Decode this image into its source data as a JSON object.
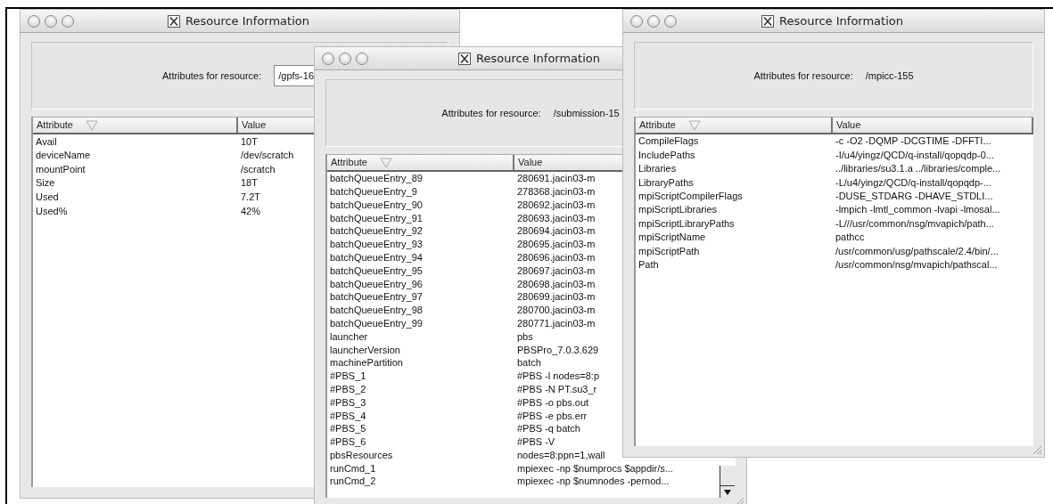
{
  "windows": [
    {
      "title": "Resource Information",
      "resource_label": "Attributes for resource:",
      "resource_value": "/gpfs-16",
      "value_boxed": true,
      "columns": [
        "Attribute",
        "Value"
      ],
      "scrollbar": false,
      "rows": [
        {
          "attribute": "Avail",
          "value": "10T"
        },
        {
          "attribute": "deviceName",
          "value": "/dev/scratch"
        },
        {
          "attribute": "mountPoint",
          "value": "/scratch"
        },
        {
          "attribute": "Size",
          "value": "18T"
        },
        {
          "attribute": "Used",
          "value": "7.2T"
        },
        {
          "attribute": "Used%",
          "value": "42%"
        }
      ]
    },
    {
      "title": "Resource Information",
      "resource_label": "Attributes for resource:",
      "resource_value": "/submission-15",
      "value_boxed": false,
      "columns": [
        "Attribute",
        "Value"
      ],
      "scrollbar": true,
      "rows": [
        {
          "attribute": "batchQueueEntry_89",
          "value": "280691.jacin03-m"
        },
        {
          "attribute": "batchQueueEntry_9",
          "value": "278368.jacin03-m"
        },
        {
          "attribute": "batchQueueEntry_90",
          "value": "280692.jacin03-m"
        },
        {
          "attribute": "batchQueueEntry_91",
          "value": "280693.jacin03-m"
        },
        {
          "attribute": "batchQueueEntry_92",
          "value": "280694.jacin03-m"
        },
        {
          "attribute": "batchQueueEntry_93",
          "value": "280695.jacin03-m"
        },
        {
          "attribute": "batchQueueEntry_94",
          "value": "280696.jacin03-m"
        },
        {
          "attribute": "batchQueueEntry_95",
          "value": "280697.jacin03-m"
        },
        {
          "attribute": "batchQueueEntry_96",
          "value": "280698.jacin03-m"
        },
        {
          "attribute": "batchQueueEntry_97",
          "value": "280699.jacin03-m"
        },
        {
          "attribute": "batchQueueEntry_98",
          "value": "280700.jacin03-m"
        },
        {
          "attribute": "batchQueueEntry_99",
          "value": "280771.jacin03-m"
        },
        {
          "attribute": "launcher",
          "value": "pbs"
        },
        {
          "attribute": "launcherVersion",
          "value": "PBSPro_7.0.3.629"
        },
        {
          "attribute": "machinePartition",
          "value": "batch"
        },
        {
          "attribute": "#PBS_1",
          "value": "#PBS -l nodes=8:p"
        },
        {
          "attribute": "#PBS_2",
          "value": "#PBS -N PT.su3_r"
        },
        {
          "attribute": "#PBS_3",
          "value": "#PBS -o pbs.out"
        },
        {
          "attribute": "#PBS_4",
          "value": "#PBS -e pbs.err"
        },
        {
          "attribute": "#PBS_5",
          "value": "#PBS -q batch"
        },
        {
          "attribute": "#PBS_6",
          "value": "#PBS -V"
        },
        {
          "attribute": "pbsResources",
          "value": "nodes=8:ppn=1,wall"
        },
        {
          "attribute": "runCmd_1",
          "value": "mpiexec -np $numprocs $appdir/s..."
        },
        {
          "attribute": "runCmd_2",
          "value": "mpiexec -np $numnodes -pernod..."
        }
      ]
    },
    {
      "title": "Resource Information",
      "resource_label": "Attributes for resource:",
      "resource_value": "/mpicc-155",
      "value_boxed": false,
      "columns": [
        "Attribute",
        "Value"
      ],
      "scrollbar": false,
      "rows": [
        {
          "attribute": "CompileFlags",
          "value": "-c -O2 -DQMP -DCGTIME -DFFTI..."
        },
        {
          "attribute": "IncludePaths",
          "value": "-I/u4/yingz/QCD/q-install/qopqdp-0..."
        },
        {
          "attribute": "Libraries",
          "value": "../libraries/su3.1.a ../libraries/comple..."
        },
        {
          "attribute": "LibraryPaths",
          "value": "-L/u4/yingz/QCD/q-install/qopqdp-..."
        },
        {
          "attribute": "mpiScriptCompilerFlags",
          "value": "-DUSE_STDARG -DHAVE_STDLI..."
        },
        {
          "attribute": "mpiScriptLibraries",
          "value": "-lmpich -lmtl_common -lvapi -lmosal..."
        },
        {
          "attribute": "mpiScriptLibraryPaths",
          "value": "-L///usr/common/nsg/mvapich/path..."
        },
        {
          "attribute": "mpiScriptName",
          "value": "pathcc"
        },
        {
          "attribute": "mpiScriptPath",
          "value": "/usr/common/usg/pathscale/2.4/bin/..."
        },
        {
          "attribute": "Path",
          "value": "/usr/common/nsg/mvapich/pathscal..."
        }
      ]
    }
  ]
}
